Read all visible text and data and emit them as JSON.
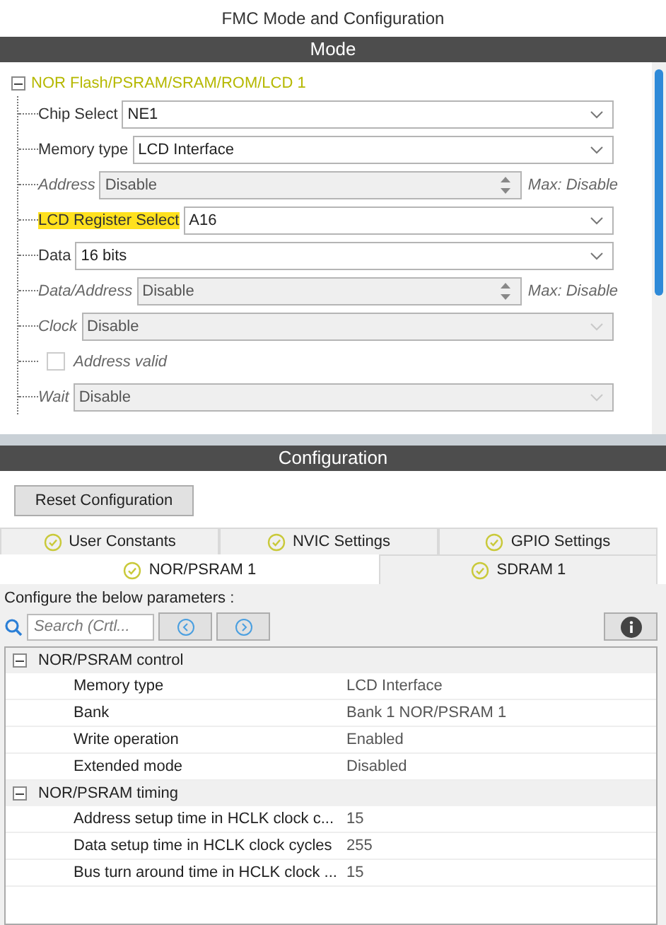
{
  "window": {
    "title": "FMC Mode and Configuration"
  },
  "mode": {
    "header": "Mode",
    "tree": {
      "label": "NOR Flash/PSRAM/SRAM/ROM/LCD 1",
      "expanded": true,
      "children": [
        {
          "kind": "select",
          "label": "Chip Select",
          "value": "NE1",
          "disabled": false,
          "highlighted": false
        },
        {
          "kind": "select",
          "label": "Memory type",
          "value": "LCD Interface",
          "disabled": false,
          "highlighted": false
        },
        {
          "kind": "spin",
          "label": "Address",
          "value": "Disable",
          "max": "Max: Disable",
          "disabled": true,
          "highlighted": false
        },
        {
          "kind": "select",
          "label": "LCD Register Select",
          "value": "A16",
          "disabled": false,
          "highlighted": true
        },
        {
          "kind": "select",
          "label": "Data",
          "value": "16 bits",
          "disabled": false,
          "highlighted": false
        },
        {
          "kind": "spin",
          "label": "Data/Address",
          "value": "Disable",
          "max": "Max: Disable",
          "disabled": true,
          "highlighted": false
        },
        {
          "kind": "select",
          "label": "Clock",
          "value": "Disable",
          "disabled": true,
          "highlighted": false
        },
        {
          "kind": "checkbox",
          "label": "Address valid",
          "checked": false,
          "disabled": true,
          "highlighted": false
        },
        {
          "kind": "select",
          "label": "Wait",
          "value": "Disable",
          "disabled": true,
          "highlighted": false
        }
      ]
    }
  },
  "configuration": {
    "header": "Configuration",
    "reset_button": "Reset Configuration",
    "tab_rows": [
      [
        {
          "label": "User Constants",
          "selected": false
        },
        {
          "label": "NVIC Settings",
          "selected": false
        },
        {
          "label": "GPIO Settings",
          "selected": false
        }
      ],
      [
        {
          "label": "NOR/PSRAM 1",
          "selected": true
        },
        {
          "label": "SDRAM 1",
          "selected": false
        }
      ]
    ],
    "instructions": "Configure the below parameters :",
    "search": {
      "placeholder": "Search (Crtl..."
    },
    "groups": [
      {
        "label": "NOR/PSRAM control",
        "expanded": true,
        "rows": [
          {
            "name": "Memory type",
            "value": "LCD Interface"
          },
          {
            "name": "Bank",
            "value": "Bank 1 NOR/PSRAM 1"
          },
          {
            "name": "Write operation",
            "value": "Enabled"
          },
          {
            "name": "Extended mode",
            "value": "Disabled"
          }
        ]
      },
      {
        "label": "NOR/PSRAM timing",
        "expanded": true,
        "rows": [
          {
            "name": "Address setup time in HCLK clock c...",
            "value": "15"
          },
          {
            "name": "Data setup time in HCLK clock cycles",
            "value": "255"
          },
          {
            "name": "Bus turn around time in HCLK clock ...",
            "value": "15"
          }
        ]
      }
    ]
  }
}
